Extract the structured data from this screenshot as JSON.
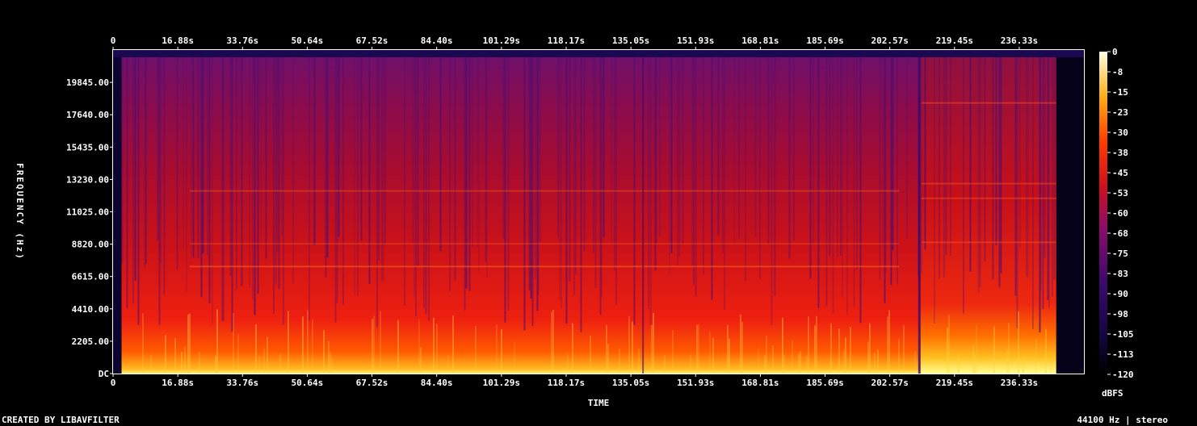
{
  "chart_data": {
    "type": "heatmap",
    "title": "",
    "xlabel": "TIME",
    "ylabel": "FREQUENCY (Hz)",
    "x_unit": "s",
    "x_ticks": [
      "0",
      "16.88s",
      "33.76s",
      "50.64s",
      "67.52s",
      "84.40s",
      "101.29s",
      "118.17s",
      "135.05s",
      "151.93s",
      "168.81s",
      "185.69s",
      "202.57s",
      "219.45s",
      "236.33s"
    ],
    "x_tick_values": [
      0,
      16.88,
      33.76,
      50.64,
      67.52,
      84.4,
      101.29,
      118.17,
      135.05,
      151.93,
      168.81,
      185.69,
      202.57,
      219.45,
      236.33
    ],
    "xlim": [
      0,
      253.2
    ],
    "y_ticks": [
      "DC",
      "2205.00",
      "4410.00",
      "6615.00",
      "8820.00",
      "11025.00",
      "13230.00",
      "15435.00",
      "17640.00",
      "19845.00"
    ],
    "y_tick_values": [
      0,
      2205,
      4410,
      6615,
      8820,
      11025,
      13230,
      15435,
      17640,
      19845
    ],
    "ylim": [
      0,
      22050
    ],
    "colorbar": {
      "label": "dBFS",
      "ticks": [
        "0",
        "-8",
        "-15",
        "-23",
        "-30",
        "-38",
        "-45",
        "-53",
        "-60",
        "-68",
        "-75",
        "-83",
        "-90",
        "-98",
        "-105",
        "-113",
        "-120"
      ],
      "range": [
        -120,
        0
      ]
    },
    "colors": {
      "low": "#000000",
      "mid_low": "#3a0a6e",
      "mid": "#cc1020",
      "mid_high": "#ff5a00",
      "high": "#ffffe0"
    }
  },
  "footer": {
    "left": "CREATED BY LIBAVFILTER",
    "right": "44100 Hz | stereo"
  }
}
